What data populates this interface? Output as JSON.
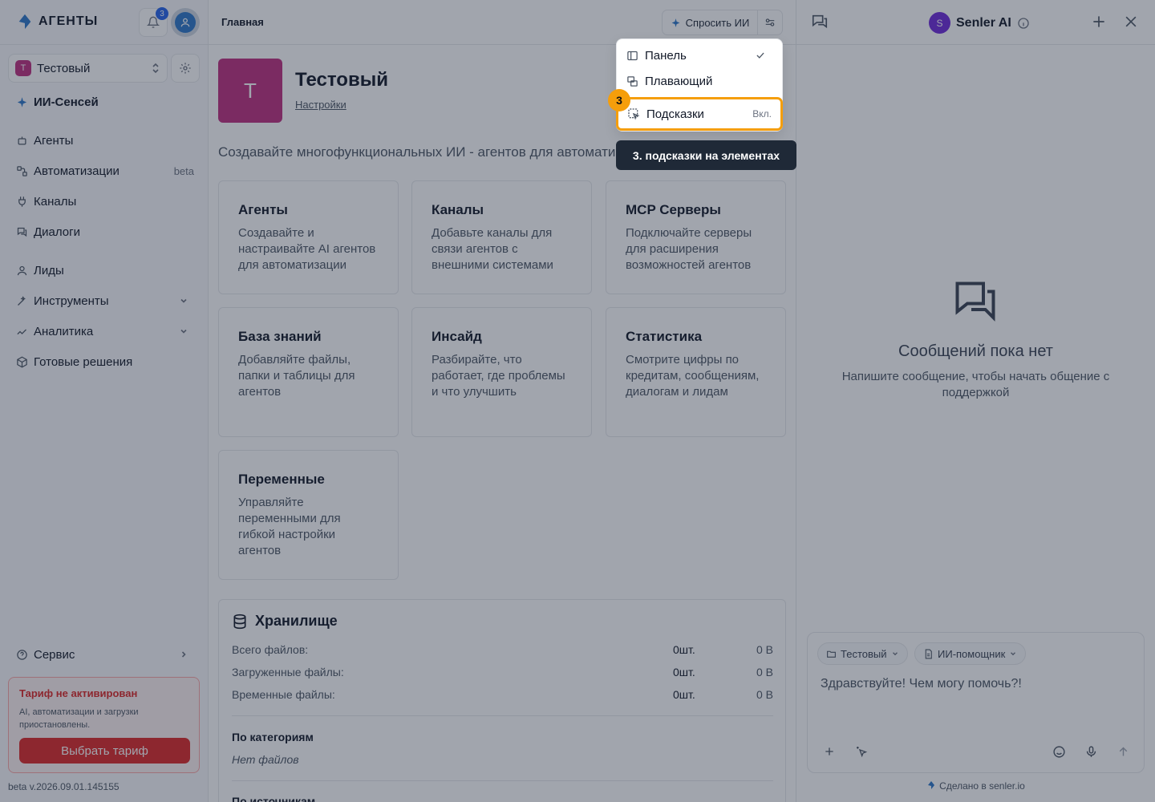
{
  "app": {
    "logo_text": "АГЕНТЫ",
    "notification_count": "3",
    "accent_color": "#2563eb"
  },
  "workspace": {
    "badge": "Т",
    "name": "Тестовый"
  },
  "sidebar": {
    "ai_item": "ИИ-Сенсей",
    "items": [
      {
        "label": "Агенты",
        "icon": "bot-icon"
      },
      {
        "label": "Автоматизации",
        "badge": "beta",
        "icon": "workflow-icon"
      },
      {
        "label": "Каналы",
        "icon": "plug-icon"
      },
      {
        "label": "Диалоги",
        "icon": "chat-icon"
      },
      {
        "label": "Лиды",
        "icon": "user-icon"
      },
      {
        "label": "Инструменты",
        "icon": "wand-icon"
      },
      {
        "label": "Аналитика",
        "icon": "chart-icon"
      },
      {
        "label": "Готовые решения",
        "icon": "box-icon"
      }
    ],
    "service": "Сервис",
    "tariff": {
      "title": "Тариф не активирован",
      "text": "AI, автоматизации и загрузки приостановлены.",
      "button": "Выбрать тариф"
    },
    "version": "beta v.2026.09.01.145155"
  },
  "topbar": {
    "breadcrumb": "Главная",
    "ask_ai": "Спросить ИИ"
  },
  "hero": {
    "badge": "Т",
    "title": "Тестовый",
    "link": "Настройки",
    "description": "Создавайте многофункциональных ИИ - агентов для автоматиз"
  },
  "cards": [
    {
      "title": "Агенты",
      "desc": "Создавайте и настраивайте AI агентов для автоматизации"
    },
    {
      "title": "Каналы",
      "desc": "Добавьте каналы для связи агентов с внешними системами"
    },
    {
      "title": "MCP Серверы",
      "desc": "Подключайте серверы для расширения возможностей агентов"
    },
    {
      "title": "База знаний",
      "desc": "Добавляйте файлы, папки и таблицы для агентов"
    },
    {
      "title": "Инсайд",
      "desc": "Разбирайте, что работает, где проблемы и что улучшить"
    },
    {
      "title": "Статистика",
      "desc": "Смотрите цифры по кредитам, сообщениям, диалогам и лидам"
    },
    {
      "title": "Переменные",
      "desc": "Управляйте переменными для гибкой настройки агентов"
    }
  ],
  "storage": {
    "title": "Хранилище",
    "rows": [
      {
        "label": "Всего файлов:",
        "count": "0шт.",
        "size": "0 B"
      },
      {
        "label": "Загруженные файлы:",
        "count": "0шт.",
        "size": "0 B"
      },
      {
        "label": "Временные файлы:",
        "count": "0шт.",
        "size": "0 B"
      }
    ],
    "by_category": "По категориям",
    "no_files": "Нет файлов",
    "by_source": "По источникам"
  },
  "menu": {
    "items": [
      {
        "label": "Панель"
      },
      {
        "label": "Плавающий"
      }
    ],
    "highlight": {
      "label": "Подсказки",
      "value": "Вкл."
    }
  },
  "tour": {
    "step": "3",
    "tooltip": "3. подсказки на элементах"
  },
  "chat": {
    "agent_initial": "S",
    "agent_name": "Senler AI",
    "empty_title": "Сообщений пока нет",
    "empty_text": "Напишите сообщение, чтобы начать общение с поддержкой",
    "chip_workspace": "Тестовый",
    "chip_mode": "ИИ-помощник",
    "input_text": "Здравствуйте! Чем могу помочь?!",
    "made_by": "Сделано в senler.io"
  }
}
